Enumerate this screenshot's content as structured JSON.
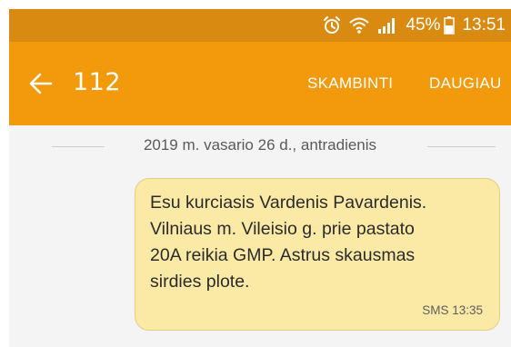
{
  "status_bar": {
    "battery_percent": "45%",
    "time": "13:51",
    "icons": [
      "alarm-icon",
      "wifi-icon",
      "signal-icon",
      "battery-icon"
    ]
  },
  "header": {
    "back_icon": "arrow-left-icon",
    "contact": "112",
    "call_label": "SKAMBINTI",
    "more_label": "DAUGIAU"
  },
  "thread": {
    "date_separator": "2019 m. vasario 26 d., antradienis",
    "messages": [
      {
        "text": "Esu kurciasis Vardenis Pavardenis.\nVilniaus m. Vileisio g. prie pastato\n20A reikia GMP. Astrus skausmas\nsirdies plote.",
        "meta": "SMS 13:35"
      }
    ]
  },
  "colors": {
    "status_bar": "#d98a10",
    "app_bar": "#f39a0c",
    "bubble": "#fbeaa6",
    "background": "#f4f4f4"
  }
}
